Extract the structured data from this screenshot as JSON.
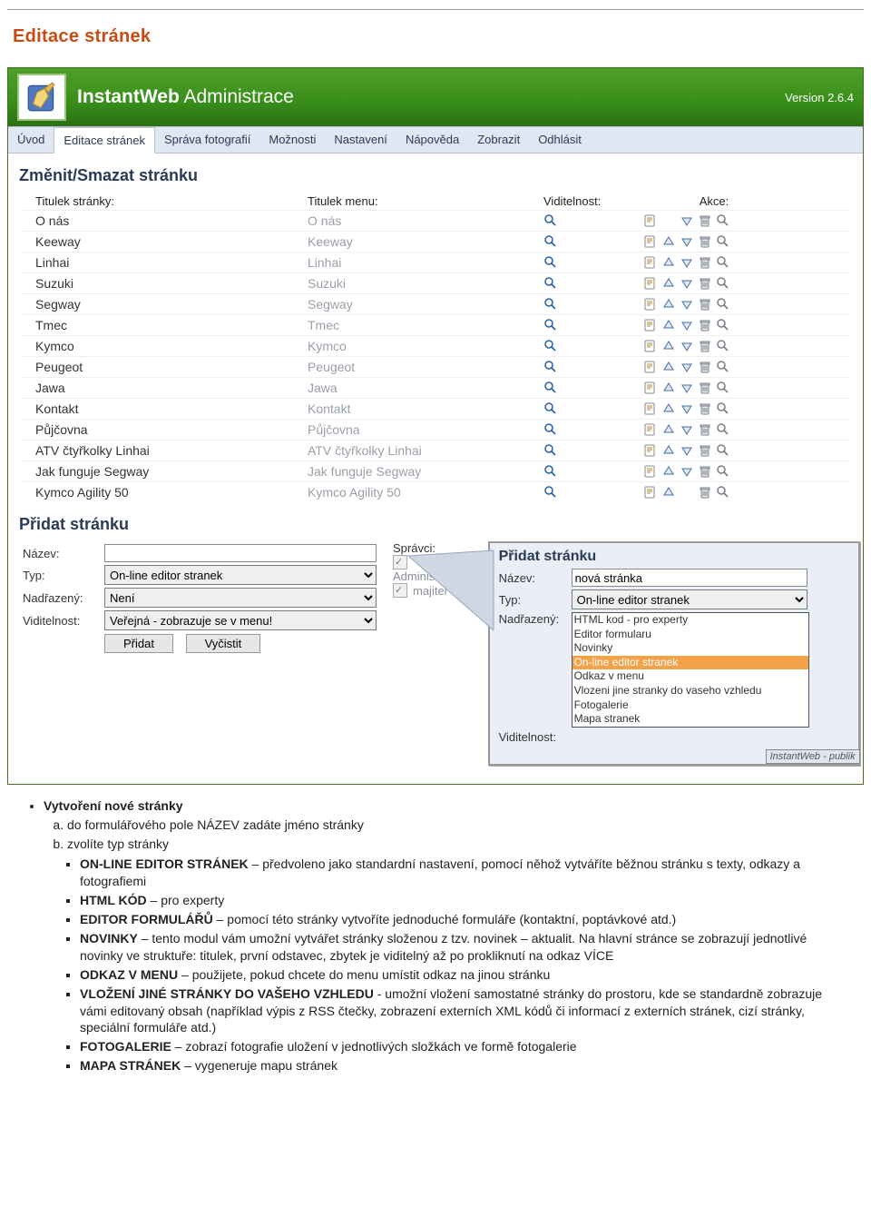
{
  "page_title": "Editace stránek",
  "header": {
    "brand_bold": "InstantWeb",
    "brand_thin": " Administrace",
    "version": "Version 2.6.4"
  },
  "menubar": [
    {
      "label": "Úvod",
      "active": false
    },
    {
      "label": "Editace stránek",
      "active": true
    },
    {
      "label": "Správa fotografií",
      "active": false
    },
    {
      "label": "Možnosti",
      "active": false
    },
    {
      "label": "Nastavení",
      "active": false
    },
    {
      "label": "Nápověda",
      "active": false
    },
    {
      "label": "Zobrazit",
      "active": false
    },
    {
      "label": "Odhlásit",
      "active": false
    }
  ],
  "list": {
    "title": "Změnit/Smazat stránku",
    "cols": {
      "c1": "Titulek stránky:",
      "c2": "Titulek menu:",
      "c3": "Viditelnost:",
      "c4": "Akce:"
    },
    "rows": [
      {
        "title": "O nás",
        "menu": "O nás",
        "up": false,
        "down": true
      },
      {
        "title": "Keeway",
        "menu": "Keeway",
        "up": true,
        "down": true
      },
      {
        "title": "Linhai",
        "menu": "Linhai",
        "up": true,
        "down": true
      },
      {
        "title": "Suzuki",
        "menu": "Suzuki",
        "up": true,
        "down": true
      },
      {
        "title": "Segway",
        "menu": "Segway",
        "up": true,
        "down": true
      },
      {
        "title": "Tmec",
        "menu": "Tmec",
        "up": true,
        "down": true
      },
      {
        "title": "Kymco",
        "menu": "Kymco",
        "up": true,
        "down": true
      },
      {
        "title": "Peugeot",
        "menu": "Peugeot",
        "up": true,
        "down": true
      },
      {
        "title": "Jawa",
        "menu": "Jawa",
        "up": true,
        "down": true
      },
      {
        "title": "Kontakt",
        "menu": "Kontakt",
        "up": true,
        "down": true
      },
      {
        "title": "Půjčovna",
        "menu": "Půjčovna",
        "up": true,
        "down": true
      },
      {
        "title": "ATV čtyřkolky Linhai",
        "menu": "ATV čtyřkolky Linhai",
        "up": true,
        "down": true
      },
      {
        "title": "Jak funguje Segway",
        "menu": "Jak funguje Segway",
        "up": true,
        "down": true
      },
      {
        "title": "Kymco Agility 50",
        "menu": "Kymco Agility 50",
        "up": true,
        "down": false
      }
    ]
  },
  "addSection": {
    "title": "Přidat stránku",
    "labels": {
      "name": "Název:",
      "type": "Typ:",
      "parent": "Nadřazený:",
      "visibility": "Viditelnost:",
      "admins": "Správci:"
    },
    "values": {
      "name": "",
      "type": "On-line editor stranek",
      "parent": "Není",
      "visibility": "Veřejná - zobrazuje se v menu!"
    },
    "admins": [
      {
        "label": "Administrátor",
        "checked": true
      },
      {
        "label": "majitel",
        "checked": true
      }
    ],
    "buttons": {
      "add": "Přidat",
      "clear": "Vyčistit"
    }
  },
  "callout": {
    "title": "Přidat stránku",
    "labels": {
      "name": "Název:",
      "type": "Typ:",
      "parent": "Nadřazený:",
      "visibility": "Viditelnost:"
    },
    "name_value": "nová stránka",
    "type_value": "On-line editor stranek",
    "options": [
      {
        "label": "HTML kod - pro experty",
        "sel": false
      },
      {
        "label": "Editor formularu",
        "sel": false
      },
      {
        "label": "Novinky",
        "sel": false
      },
      {
        "label": "On-line editor stranek",
        "sel": true
      },
      {
        "label": "Odkaz v menu",
        "sel": false
      },
      {
        "label": "Vlozeni jine stranky do vaseho vzhledu",
        "sel": false
      },
      {
        "label": "Fotogalerie",
        "sel": false
      },
      {
        "label": "Mapa stranek",
        "sel": false
      }
    ],
    "footer": "InstantWeb - publik"
  },
  "doc": {
    "heading": "Vytvoření nové stránky",
    "a": "do formulářového pole NÁZEV zadáte jméno stránky",
    "b": "zvolíte typ stránky",
    "items": [
      {
        "b": "ON-LINE EDITOR STRÁNEK",
        "t": " – předvoleno jako standardní nastavení, pomocí něhož vytváříte běžnou stránku s texty, odkazy a fotografiemi"
      },
      {
        "b": "HTML KÓD",
        "t": " – pro experty"
      },
      {
        "b": "EDITOR FORMULÁŘŮ",
        "t": " – pomocí této stránky vytvoříte jednoduché formuláře (kontaktní, poptávkové atd.)"
      },
      {
        "b": "NOVINKY",
        "t": " – tento modul vám umožní vytvářet stránky složenou z tzv. novinek – aktualit. Na hlavní stránce se zobrazují jednotlivé novinky ve struktuře: titulek, první odstavec, zbytek je viditelný až po prokliknutí na odkaz VÍCE"
      },
      {
        "b": "ODKAZ V MENU",
        "t": " – použijete, pokud chcete do menu umístit odkaz na jinou stránku"
      },
      {
        "b": "VLOŽENÍ JINÉ STRÁNKY DO VAŠEHO VZHLEDU",
        "t": " - umožní vložení samostatné stránky do prostoru, kde se standardně zobrazuje vámi editovaný obsah (například výpis z RSS čtečky, zobrazení externích XML kódů či informací z externích stránek, cizí stránky, speciální formuláře atd.)"
      },
      {
        "b": "FOTOGALERIE",
        "t": " – zobrazí fotografie uložení v jednotlivých složkách ve formě fotogalerie"
      },
      {
        "b": "MAPA STRÁNEK",
        "t": " – vygeneruje mapu stránek"
      }
    ]
  }
}
